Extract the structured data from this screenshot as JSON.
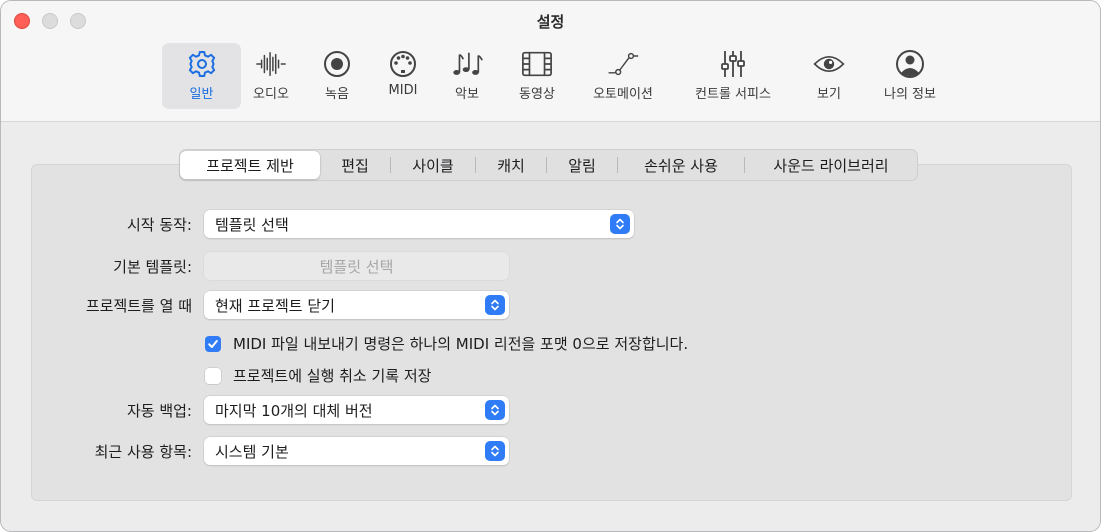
{
  "window": {
    "title": "설정"
  },
  "toolbar": {
    "items": [
      {
        "label": "일반",
        "icon": "gear-icon",
        "selected": true
      },
      {
        "label": "오디오",
        "icon": "waveform-icon"
      },
      {
        "label": "녹음",
        "icon": "record-icon"
      },
      {
        "label": "MIDI",
        "icon": "midi-icon"
      },
      {
        "label": "악보",
        "icon": "music-notes-icon"
      },
      {
        "label": "동영상",
        "icon": "film-icon"
      },
      {
        "label": "오토메이션",
        "icon": "automation-icon"
      },
      {
        "label": "컨트롤 서피스",
        "icon": "sliders-icon"
      },
      {
        "label": "보기",
        "icon": "eye-icon"
      },
      {
        "label": "나의 정보",
        "icon": "person-icon"
      }
    ],
    "accent_color": "#1b6fe0"
  },
  "tabs": [
    {
      "label": "프로젝트 제반",
      "active": true
    },
    {
      "label": "편집"
    },
    {
      "label": "사이클"
    },
    {
      "label": "캐치"
    },
    {
      "label": "알림"
    },
    {
      "label": "손쉬운 사용"
    },
    {
      "label": "사운드 라이브러리"
    }
  ],
  "form": {
    "startup": {
      "label": "시작 동작:",
      "value": "템플릿 선택"
    },
    "default_template": {
      "label": "기본 템플릿:",
      "button": "템플릿 선택"
    },
    "on_open": {
      "label": "프로젝트를 열 때",
      "value": "현재 프로젝트 닫기"
    },
    "midi_export": {
      "label": "MIDI 파일 내보내기 명령은 하나의 MIDI 리전을 포맷 0으로 저장합니다.",
      "checked": true
    },
    "save_undo": {
      "label": "프로젝트에 실행 취소 기록 저장",
      "checked": false
    },
    "auto_backup": {
      "label": "자동 백업:",
      "value": "마지막 10개의 대체 버전"
    },
    "recent_items": {
      "label": "최근 사용 항목:",
      "value": "시스템 기본"
    }
  },
  "colors": {
    "checkbox_on": "#2f7cf6",
    "close": "#ff5f57"
  }
}
